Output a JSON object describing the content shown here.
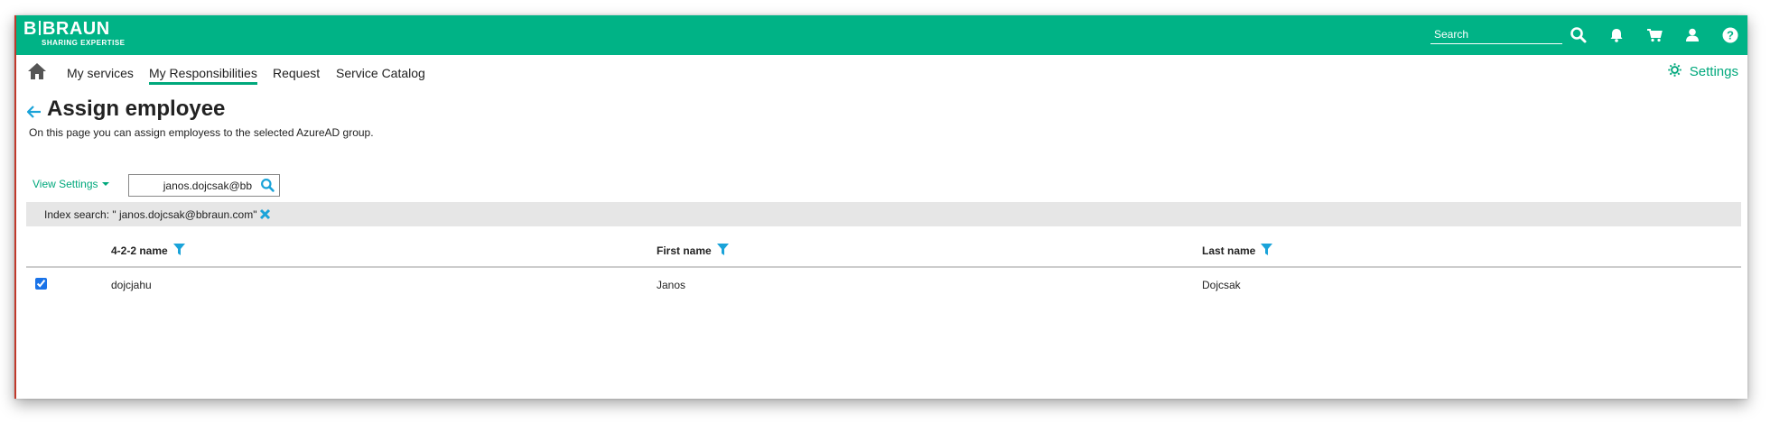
{
  "header": {
    "logo_main": "BRAUN",
    "logo_prefix": "B",
    "logo_tagline": "SHARING EXPERTISE",
    "search_placeholder": "Search",
    "icons": [
      "search-icon",
      "bell-icon",
      "cart-icon",
      "user-icon",
      "help-icon"
    ],
    "brand_color": "#00b386"
  },
  "nav": {
    "items": [
      {
        "label": "My services"
      },
      {
        "label": "My Responsibilities",
        "active": true
      },
      {
        "label": "Request"
      },
      {
        "label": "Service Catalog"
      }
    ],
    "settings_label": "Settings"
  },
  "page": {
    "title": "Assign employee",
    "description": "On this page you can assign employess to the selected AzureAD group."
  },
  "toolbar": {
    "view_settings_label": "View Settings",
    "search_value": "janos.dojcsak@bb",
    "index_search_text": "Index search: \" janos.dojcsak@bbraun.com\""
  },
  "table": {
    "columns": [
      "4-2-2 name",
      "First name",
      "Last name"
    ],
    "rows": [
      {
        "checked": true,
        "cells": [
          "dojcjahu",
          "Janos",
          "Dojcsak"
        ]
      }
    ]
  },
  "colors": {
    "accent": "#00a87c",
    "icon_blue": "#1aa3d9"
  }
}
